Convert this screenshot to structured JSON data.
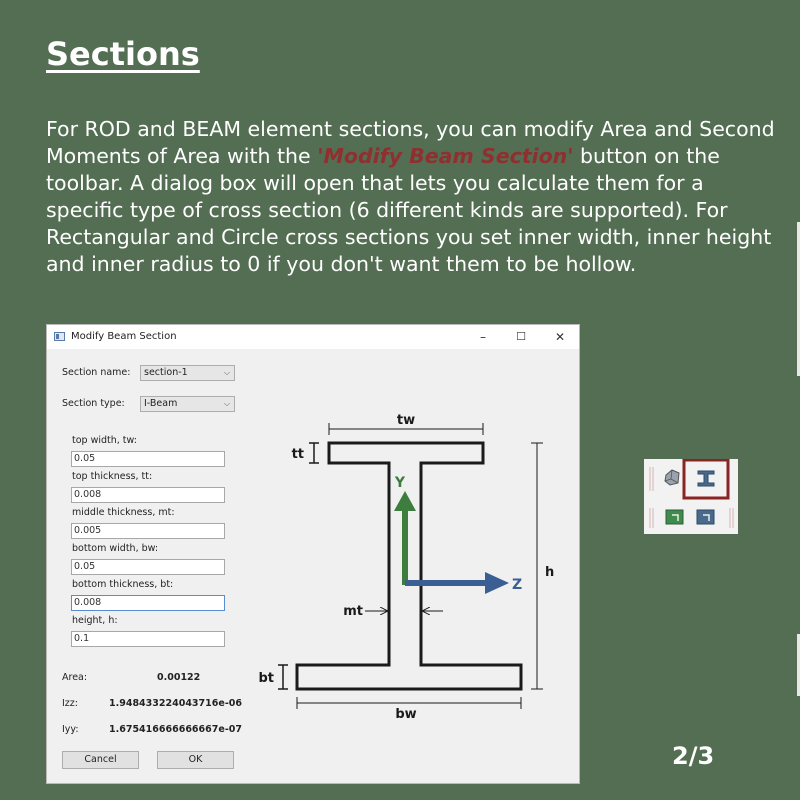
{
  "slide": {
    "title": "Sections",
    "paragraph_before": "For ROD and BEAM element sections, you can modify Area and Second Moments of Area with the ",
    "paragraph_highlight": "'Modify Beam Section'",
    "paragraph_after": " button on the toolbar. A dialog box will open that lets you calculate them for a specific type of cross section (6 different kinds are supported). For Rectangular and Circle cross sections you set inner width, inner height and inner radius to 0 if you don't want them to be hollow.",
    "page_number": "2/3"
  },
  "dialog": {
    "title": "Modify Beam Section",
    "minimize": "–",
    "maximize": "☐",
    "close": "✕",
    "section_name_label": "Section name:",
    "section_name_value": "section-1",
    "section_type_label": "Section type:",
    "section_type_value": "I-Beam",
    "fields": [
      {
        "label": "top width, tw:",
        "value": "0.05"
      },
      {
        "label": "top thickness, tt:",
        "value": "0.008"
      },
      {
        "label": "middle thickness, mt:",
        "value": "0.005"
      },
      {
        "label": "bottom width, bw:",
        "value": "0.05"
      },
      {
        "label": "bottom thickness, bt:",
        "value": "0.008"
      },
      {
        "label": "height, h:",
        "value": "0.1"
      }
    ],
    "results": {
      "area_label": "Area:",
      "area_value": "0.00122",
      "izz_label": "Izz:",
      "izz_value": "1.948433224043716e-06",
      "iyy_label": "Iyy:",
      "iyy_value": "1.675416666666667e-07"
    },
    "cancel_label": "Cancel",
    "ok_label": "OK"
  },
  "diagram": {
    "tw": "tw",
    "tt": "tt",
    "mt": "mt",
    "bw": "bw",
    "bt": "bt",
    "h": "h",
    "y_axis": "Y",
    "z_axis": "Z",
    "colors": {
      "y_axis": "#3d7d3d",
      "z_axis": "#3b5e93",
      "outline": "#1a1a1a"
    }
  },
  "toolbar": {
    "highlight_color": "#8b2323",
    "icons": [
      "polyhedron-icon",
      "i-beam-section-icon",
      "green-section-icon",
      "blue-section-icon"
    ]
  }
}
